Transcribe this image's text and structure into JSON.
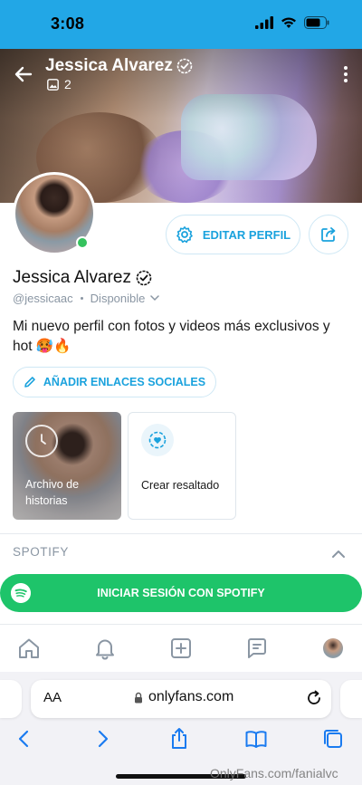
{
  "status_bar": {
    "time": "3:08"
  },
  "header": {
    "name": "Jessica Alvarez",
    "media_count": "2"
  },
  "profile": {
    "name": "Jessica Alvarez",
    "handle": "@jessicaac",
    "availability": "Disponible",
    "bio": "Mi nuevo perfil con fotos y videos más exclusivos y hot 🥵🔥",
    "online": true
  },
  "actions": {
    "edit_profile": "EDITAR PERFIL",
    "add_social_links": "AÑADIR ENLACES SOCIALES"
  },
  "highlights": {
    "archive_label": "Archivo de historias",
    "create_label": "Crear resaltado"
  },
  "spotify": {
    "section_title": "SPOTIFY",
    "login_button": "INICIAR SESIÓN CON SPOTIFY"
  },
  "bottom_nav": [
    "home-icon",
    "bell-icon",
    "plus-square-icon",
    "message-icon",
    "avatar"
  ],
  "browser": {
    "text_size_label": "AA",
    "url": "onlyfans.com"
  },
  "watermark": "OnlyFans.com/fanialvc",
  "colors": {
    "status_bar": "#22a7e6",
    "accent": "#1aa2dd",
    "online": "#35c25e",
    "spotify": "#1ec46a"
  }
}
